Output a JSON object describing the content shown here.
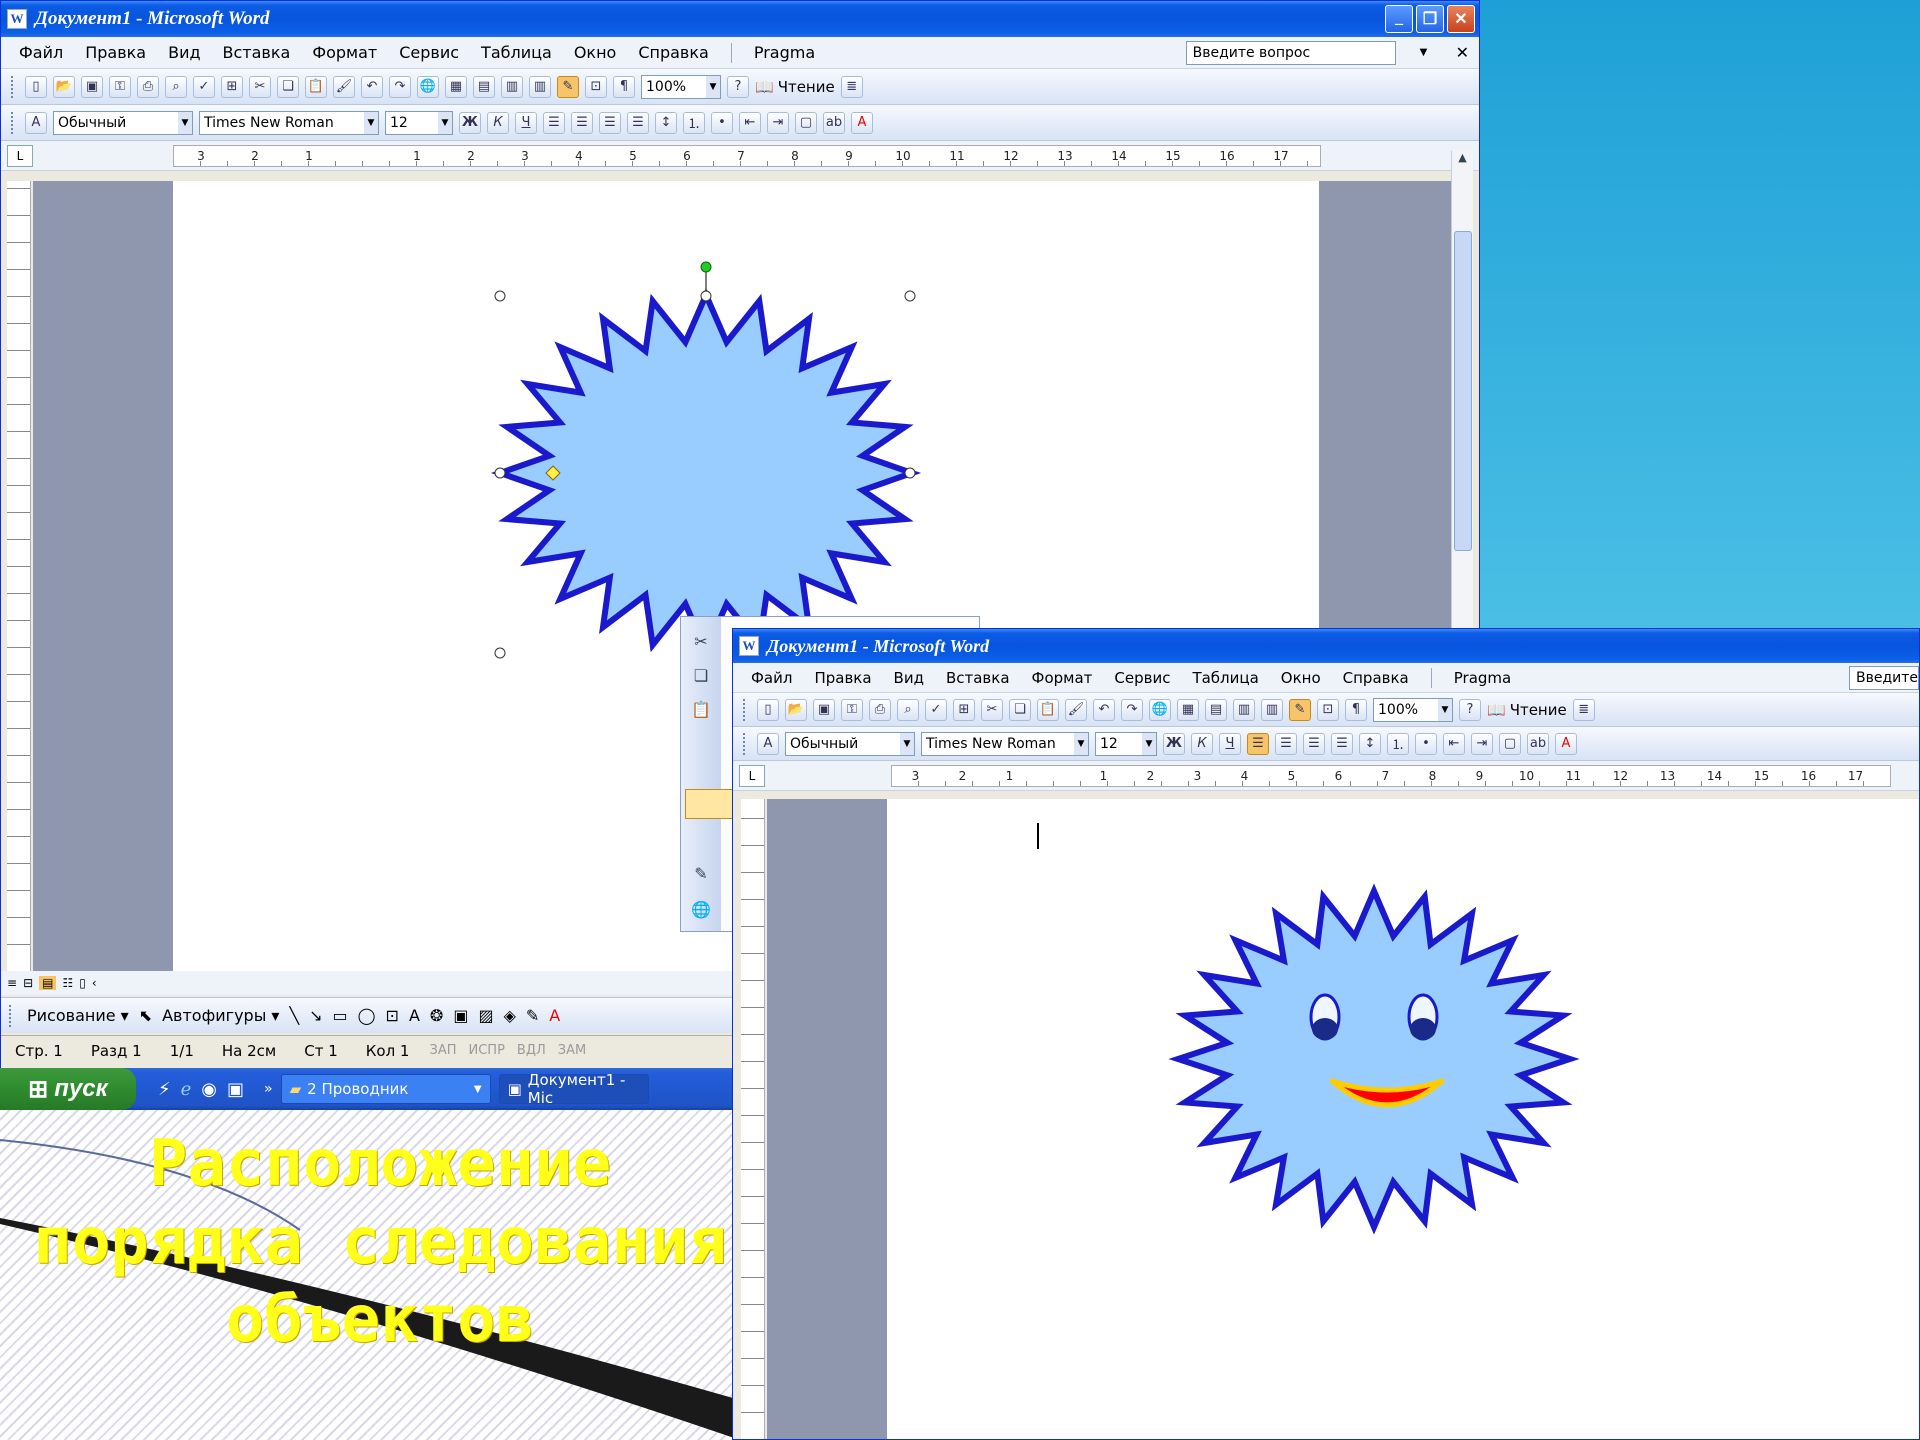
{
  "slide": {
    "title_line1": "Расположение",
    "title_line2": "порядка следования",
    "title_line3": "объектов"
  },
  "window1": {
    "title": "Документ1 - Microsoft Word",
    "menu": [
      "Файл",
      "Правка",
      "Вид",
      "Вставка",
      "Формат",
      "Сервис",
      "Таблица",
      "Окно",
      "Справка",
      "Pragma"
    ],
    "ask_placeholder": "Введите вопрос",
    "zoom": "100%",
    "read_label": "Чтение",
    "style": "Обычный",
    "font": "Times New Roman",
    "size": "12",
    "ruler_labels": [
      "3",
      "2",
      "1",
      "",
      "1",
      "2",
      "3",
      "4",
      "5",
      "6",
      "7",
      "8",
      "9",
      "10",
      "11",
      "12",
      "13",
      "14",
      "15",
      "16",
      "17"
    ],
    "draw_label": "Рисование",
    "autoshapes_label": "Автофигуры",
    "status": {
      "page": "Стр. 1",
      "section": "Разд 1",
      "pages": "1/1",
      "at": "На 2см",
      "line": "Ст 1",
      "col": "Кол 1",
      "rec": "ЗАП",
      "trk": "ИСПР",
      "ext": "ВДЛ",
      "ovr": "ЗАМ"
    }
  },
  "taskbar": {
    "start": "пуск",
    "task1": "2 Проводник",
    "task2": "Документ1 - Mic"
  },
  "window2": {
    "title": "Документ1 - Microsoft Word",
    "menu": [
      "Файл",
      "Правка",
      "Вид",
      "Вставка",
      "Формат",
      "Сервис",
      "Таблица",
      "Окно",
      "Справка",
      "Pragma"
    ],
    "ask_placeholder": "Введите",
    "zoom": "100%",
    "read_label": "Чтение",
    "style": "Обычный",
    "font": "Times New Roman",
    "size": "12"
  },
  "colors": {
    "star_fill": "#99ccff",
    "star_stroke": "#1a1acc",
    "mouth": "#ff0000",
    "mouth_outline": "#ffcc00",
    "slide_title": "#ffff1a"
  }
}
